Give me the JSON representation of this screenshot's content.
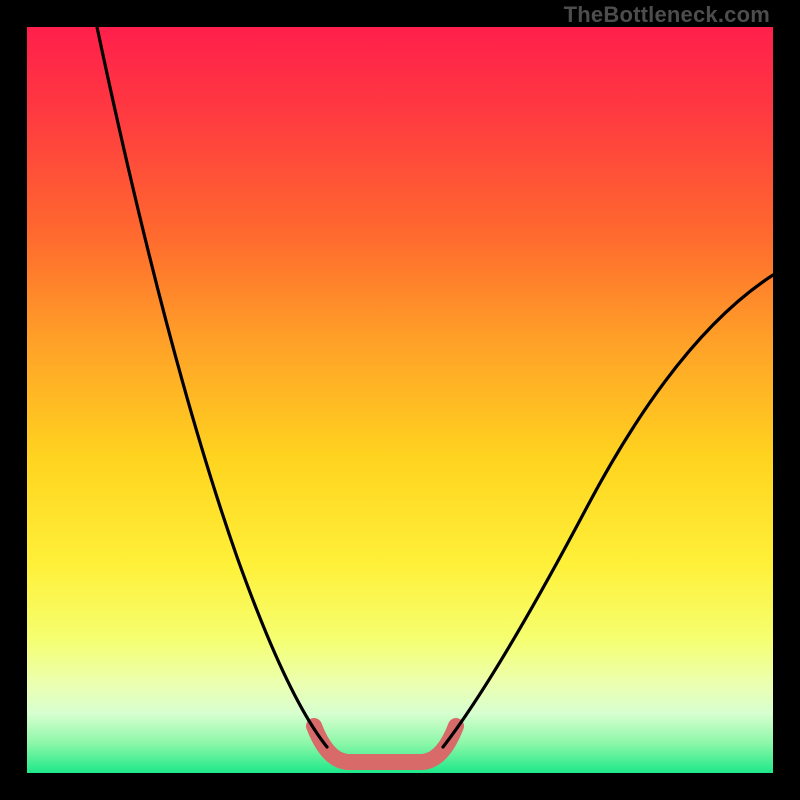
{
  "watermark": "TheBottleneck.com",
  "chart_data": {
    "type": "line",
    "title": "",
    "xlabel": "",
    "ylabel": "",
    "xlim": [
      0,
      100
    ],
    "ylim": [
      0,
      100
    ],
    "background": {
      "type": "vertical-gradient",
      "stops": [
        {
          "pos": 0.0,
          "color": "#ff1f4b"
        },
        {
          "pos": 0.12,
          "color": "#ff3b40"
        },
        {
          "pos": 0.28,
          "color": "#ff6a2e"
        },
        {
          "pos": 0.42,
          "color": "#ffa028"
        },
        {
          "pos": 0.58,
          "color": "#ffd41f"
        },
        {
          "pos": 0.72,
          "color": "#fff039"
        },
        {
          "pos": 0.82,
          "color": "#f5ff70"
        },
        {
          "pos": 0.88,
          "color": "#ecffb0"
        },
        {
          "pos": 0.92,
          "color": "#d8ffd0"
        },
        {
          "pos": 0.96,
          "color": "#8cf7a8"
        },
        {
          "pos": 1.0,
          "color": "#1ee88a"
        }
      ]
    },
    "series": [
      {
        "name": "left-curve",
        "color": "#000000",
        "x": [
          9,
          15,
          22,
          28,
          33,
          37,
          40
        ],
        "y": [
          100,
          70,
          45,
          29,
          14,
          6,
          3
        ]
      },
      {
        "name": "right-curve",
        "color": "#000000",
        "x": [
          56,
          60,
          66,
          75,
          85,
          95,
          100
        ],
        "y": [
          3,
          8,
          20,
          36,
          52,
          62,
          67
        ]
      },
      {
        "name": "bottom-highlight",
        "color": "#d86a6a",
        "stroke_width": 16,
        "x": [
          38,
          41,
          43,
          53,
          55,
          58
        ],
        "y": [
          6,
          2,
          1,
          1,
          2,
          6
        ]
      }
    ],
    "annotations": [
      {
        "text": "TheBottleneck.com",
        "position": "top-right",
        "color": "#4d4d4d"
      }
    ]
  }
}
